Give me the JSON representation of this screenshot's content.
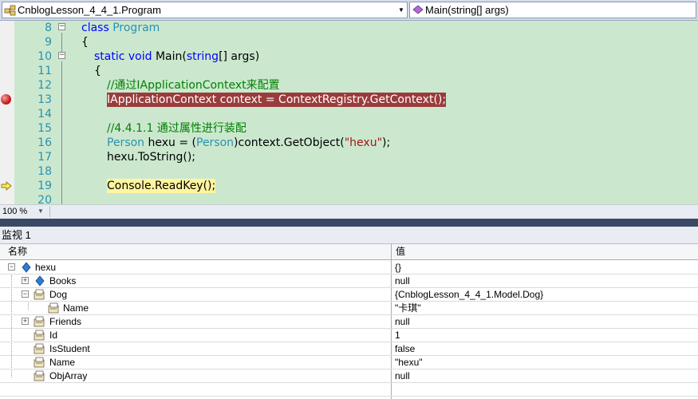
{
  "navbar": {
    "class_combo": "CnblogLesson_4_4_1.Program",
    "member_combo": "Main(string[] args)",
    "class_icon": "class-icon",
    "member_icon": "method-icon"
  },
  "editor": {
    "lines": [
      {
        "num": "8"
      },
      {
        "num": "9",
        "text": "{"
      },
      {
        "num": "10"
      },
      {
        "num": "11",
        "text": "{"
      },
      {
        "num": "12",
        "comment": "//通过IApplicationContext来配置"
      },
      {
        "num": "13",
        "text": "IApplicationContext context = ContextRegistry.GetContext();"
      },
      {
        "num": "14"
      },
      {
        "num": "15",
        "comment": "//4.4.1.1 通过属性进行装配"
      },
      {
        "num": "16"
      },
      {
        "num": "17",
        "text": "hexu.ToString();"
      },
      {
        "num": "18"
      },
      {
        "num": "19",
        "text": "Console.ReadKey();"
      },
      {
        "num": "20"
      }
    ],
    "l8": {
      "kw": "class",
      "ty": "Program"
    },
    "l10": {
      "kw": "static void",
      "name": "Main(",
      "ty": "string",
      "rest": "[] args)"
    },
    "l16": {
      "ty1": "Person",
      "a": " hexu = (",
      "ty2": "Person",
      "b": ")context.GetObject(",
      "str": "\"hexu\"",
      "c": ");"
    }
  },
  "zoom": {
    "level": "100 %"
  },
  "watch": {
    "title": "监视 1",
    "col_name": "名称",
    "col_value": "值",
    "rows": [
      {
        "name": "hexu",
        "value": "{}"
      },
      {
        "name": "Books",
        "value": "null"
      },
      {
        "name": "Dog",
        "value": "{CnblogLesson_4_4_1.Model.Dog}"
      },
      {
        "name": "Name",
        "value": "\"卡琪\""
      },
      {
        "name": "Friends",
        "value": "null"
      },
      {
        "name": "Id",
        "value": "1"
      },
      {
        "name": "IsStudent",
        "value": "false"
      },
      {
        "name": "Name",
        "value": "\"hexu\""
      },
      {
        "name": "ObjArray",
        "value": "null"
      }
    ]
  }
}
